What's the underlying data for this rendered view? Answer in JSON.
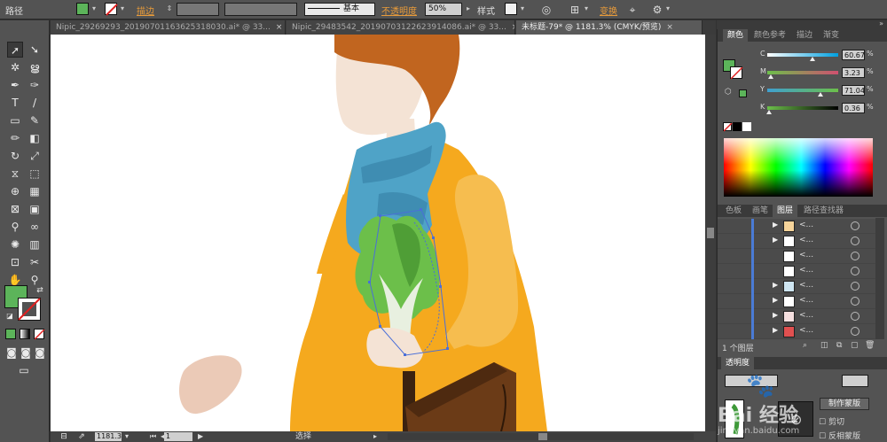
{
  "control_bar": {
    "selection_type": "路径",
    "stroke_label": "描边",
    "stroke_value": "",
    "profile_label": "基本",
    "opacity_label": "不透明度",
    "opacity_value": "50%",
    "style_label": "样式",
    "recolor_label": "变换"
  },
  "colors": {
    "fill": "#5cb45a",
    "canvas": "#ffffff",
    "scarf": "#4fa3c7",
    "dress": "#f5a91e",
    "arm": "#f6bd4f",
    "hair": "#c1651f",
    "skin": "#f4e3d5",
    "bag": "#6b3b17",
    "lettuce": "#6cbf4a",
    "selection": "#4a6fd8"
  },
  "doc_tabs": [
    {
      "label": "Nipic_29269293_20190701163625318030.ai* @ 33...",
      "close": "×"
    },
    {
      "label": "Nipic_29483542_20190703122623914086.ai* @ 33...",
      "close": "×"
    },
    {
      "label": "未标题-79* @ 1181.3% (CMYK/预览)",
      "close": "×"
    }
  ],
  "tools": [
    "selection-tool",
    "direct-selection-tool",
    "magic-wand-tool",
    "lasso-tool",
    "pen-tool",
    "curvature-tool",
    "type-tool",
    "line-tool",
    "rectangle-tool",
    "paintbrush-tool",
    "pencil-tool",
    "eraser-tool",
    "rotate-tool",
    "scale-tool",
    "width-tool",
    "free-transform-tool",
    "shape-builder-tool",
    "perspective-tool",
    "mesh-tool",
    "gradient-tool",
    "eyedropper-tool",
    "blend-tool",
    "symbol-sprayer-tool",
    "graph-tool",
    "artboard-tool",
    "slice-tool",
    "hand-tool",
    "zoom-tool"
  ],
  "color_panel": {
    "tabs": [
      "颜色",
      "颜色参考",
      "描边",
      "渐变"
    ],
    "channels": [
      {
        "name": "C",
        "value": "60.67",
        "unit": "%"
      },
      {
        "name": "M",
        "value": "3.23",
        "unit": "%"
      },
      {
        "name": "Y",
        "value": "71.04",
        "unit": "%"
      },
      {
        "name": "K",
        "value": "0.36",
        "unit": "%"
      }
    ]
  },
  "layers_panel": {
    "tabs": [
      "色板",
      "画笔",
      "图层",
      "路径查找器"
    ],
    "rows": [
      {
        "name": "<...",
        "expandable": true
      },
      {
        "name": "<...",
        "expandable": true
      },
      {
        "name": "<...",
        "expandable": false
      },
      {
        "name": "<...",
        "expandable": false
      },
      {
        "name": "<...",
        "expandable": true
      },
      {
        "name": "<...",
        "expandable": true
      },
      {
        "name": "<...",
        "expandable": true
      },
      {
        "name": "<...",
        "expandable": true
      }
    ],
    "footer": "1 个图层"
  },
  "transparency_panel": {
    "tab": "透明度",
    "make_mask_button": "制作蒙版",
    "clip_label": "剪切",
    "invert_label": "反相蒙版"
  },
  "status_bar": {
    "zoom": "1181.3",
    "artboard": "1",
    "tool_name": "选择"
  },
  "watermark": {
    "text": "Bai 经验",
    "sub": "jingyan.baidu.com"
  }
}
